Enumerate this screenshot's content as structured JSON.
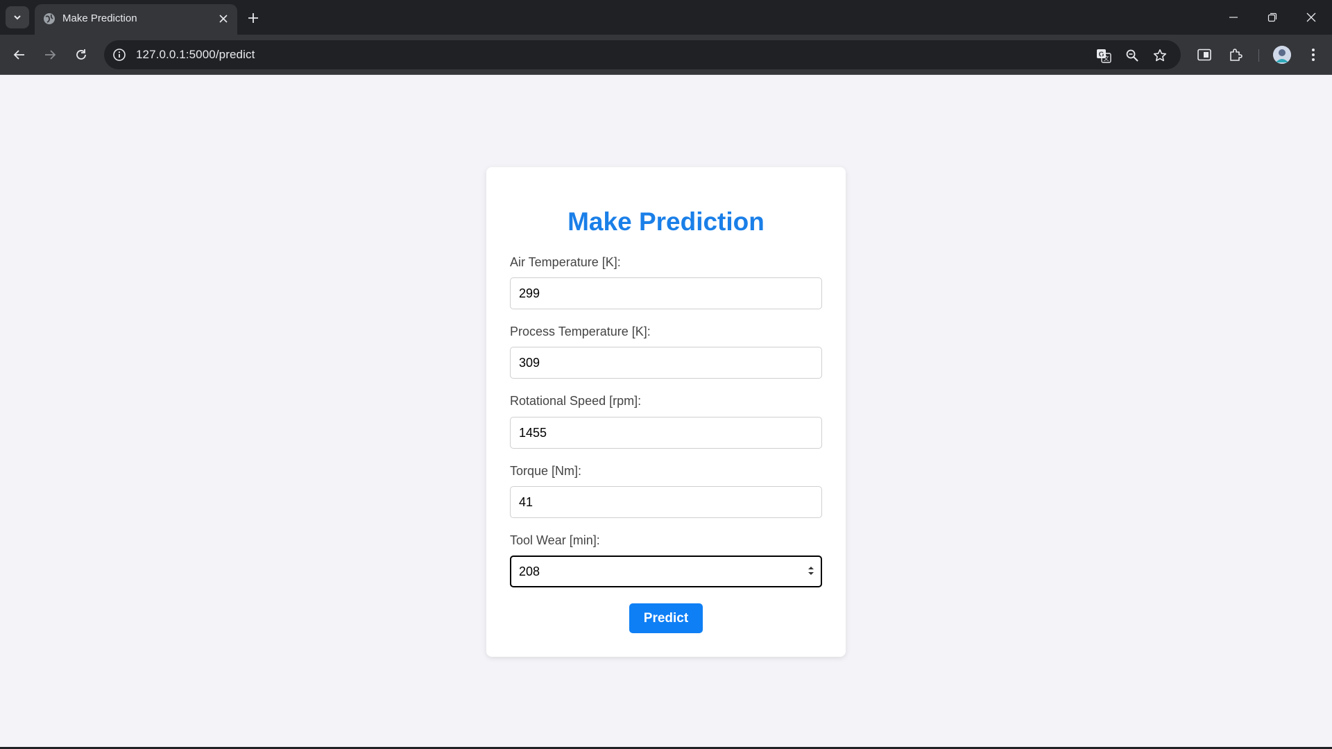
{
  "browser": {
    "tab_title": "Make Prediction",
    "url": "127.0.0.1:5000/predict"
  },
  "page": {
    "heading": "Make Prediction",
    "accent_color": "#1a7fe8",
    "fields": [
      {
        "label": "Air Temperature [K]:",
        "value": "299"
      },
      {
        "label": "Process Temperature [K]:",
        "value": "309"
      },
      {
        "label": "Rotational Speed [rpm]:",
        "value": "1455"
      },
      {
        "label": "Torque [Nm]:",
        "value": "41"
      },
      {
        "label": "Tool Wear [min]:",
        "value": "208"
      }
    ],
    "submit_label": "Predict"
  },
  "icons": [
    "tab-search-icon",
    "globe-icon",
    "close-icon",
    "plus-icon",
    "minimize-icon",
    "restore-icon",
    "back-icon",
    "forward-icon",
    "reload-icon",
    "info-icon",
    "translate-icon",
    "zoom-icon",
    "star-icon",
    "sidepanel-icon",
    "extensions-icon",
    "avatar",
    "menu-icon"
  ]
}
